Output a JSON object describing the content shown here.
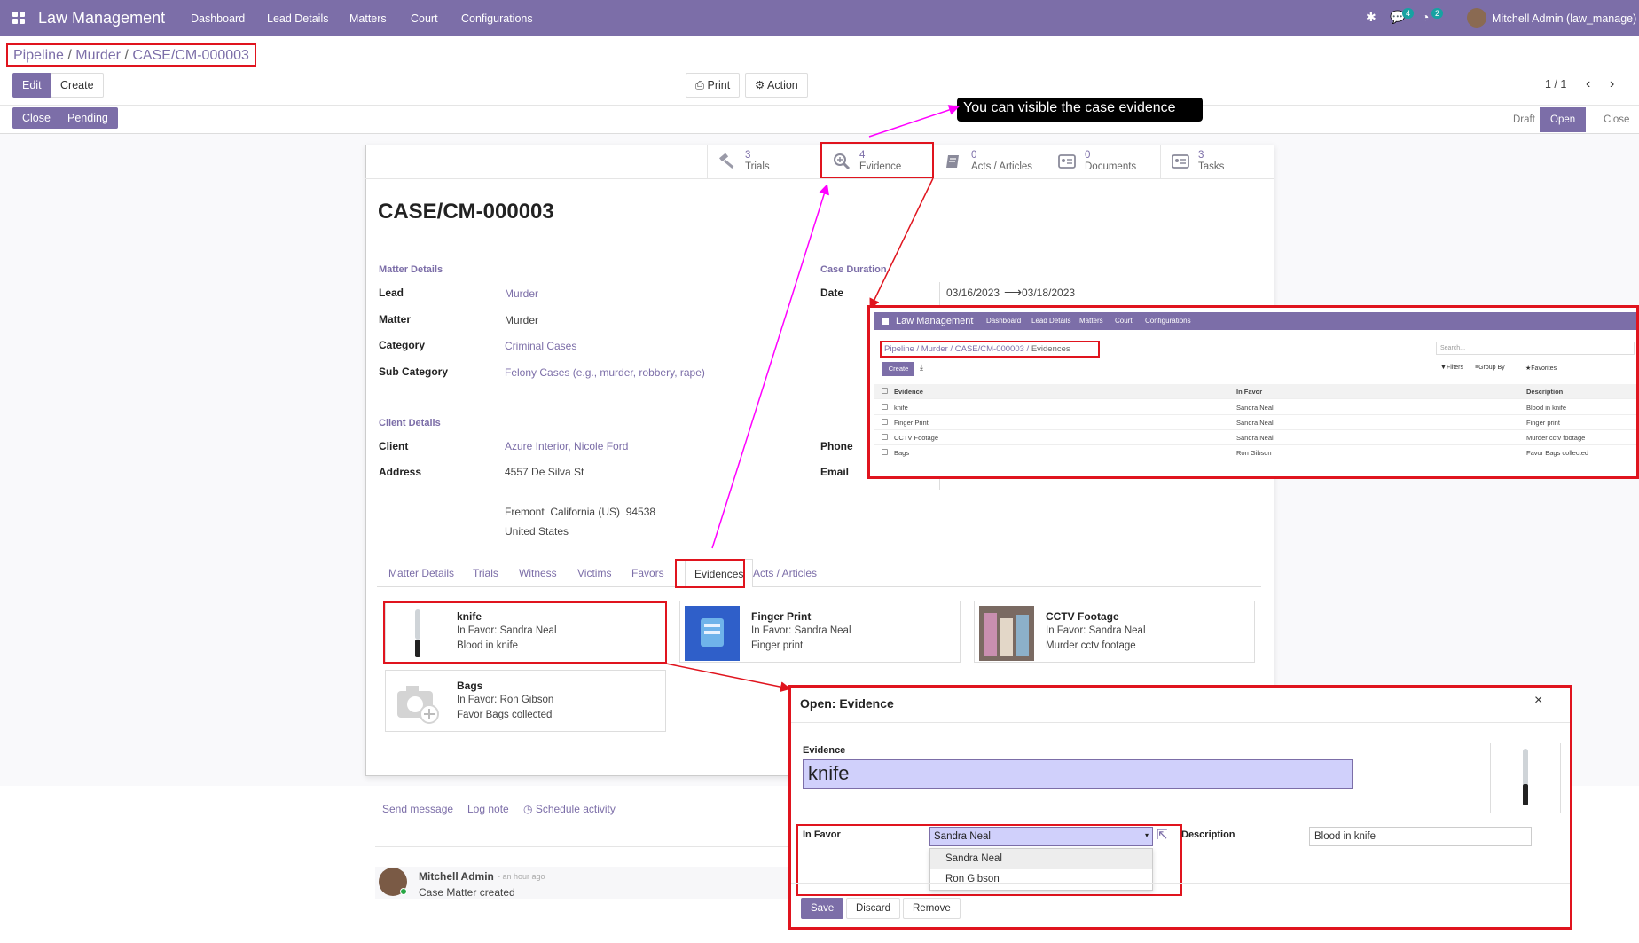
{
  "navbar": {
    "brand": "Law Management",
    "menu": [
      "Dashboard",
      "Lead Details",
      "Matters",
      "Court",
      "Configurations"
    ],
    "messages_count": "4",
    "activities_count": "2",
    "user": "Mitchell Admin (law_manage)"
  },
  "breadcrumb": {
    "items": [
      "Pipeline",
      "Murder"
    ],
    "current": "CASE/CM-000003"
  },
  "buttons": {
    "edit": "Edit",
    "create": "Create",
    "print": "Print",
    "action": "Action",
    "close": "Close",
    "pending": "Pending"
  },
  "pager": "1 / 1",
  "stages": [
    "Draft",
    "Open",
    "Close"
  ],
  "active_stage": "Open",
  "tooltip": "You can visible the case evidence",
  "smart_buttons": [
    {
      "count": "3",
      "label": "Trials",
      "icon": "gavel-icon"
    },
    {
      "count": "4",
      "label": "Evidence",
      "icon": "search-plus-icon"
    },
    {
      "count": "0",
      "label": "Acts / Articles",
      "icon": "book-icon"
    },
    {
      "count": "0",
      "label": "Documents",
      "icon": "id-card-icon"
    },
    {
      "count": "3",
      "label": "Tasks",
      "icon": "id-card-icon"
    }
  ],
  "case": {
    "title": "CASE/CM-000003"
  },
  "matter_details": {
    "heading": "Matter Details",
    "lead_label": "Lead",
    "lead": "Murder",
    "matter_label": "Matter",
    "matter": "Murder",
    "category_label": "Category",
    "category": "Criminal Cases",
    "subcategory_label": "Sub Category",
    "subcategory": "Felony Cases (e.g., murder, robbery, rape)"
  },
  "case_duration": {
    "heading": "Case Duration",
    "date_label": "Date",
    "start": "03/16/2023",
    "end": "03/18/2023"
  },
  "client_details": {
    "heading": "Client Details",
    "client_label": "Client",
    "client": "Azure Interior, Nicole Ford",
    "address_label": "Address",
    "street": "4557 De Silva St",
    "city_line": "Fremont  California (US)  94538",
    "country": "United States",
    "phone_label": "Phone",
    "email_label": "Email"
  },
  "tabs": [
    "Matter Details",
    "Trials",
    "Witness",
    "Victims",
    "Favors",
    "Evidences",
    "Acts / Articles"
  ],
  "active_tab": "Evidences",
  "evidence_cards": [
    {
      "title": "knife",
      "favor": "In Favor: Sandra Neal",
      "desc": "Blood in knife"
    },
    {
      "title": "Finger Print",
      "favor": "In Favor: Sandra Neal",
      "desc": "Finger print"
    },
    {
      "title": "CCTV Footage",
      "favor": "In Favor: Sandra Neal",
      "desc": "Murder cctv footage"
    },
    {
      "title": "Bags",
      "favor": "In Favor: Ron Gibson",
      "desc": "Favor Bags collected"
    }
  ],
  "chatter": {
    "send_message": "Send message",
    "log_note": "Log note",
    "schedule_activity": "Schedule activity",
    "author": "Mitchell Admin",
    "time": "- an hour ago",
    "message": "Case Matter created"
  },
  "inset_list": {
    "brand": "Law Management",
    "menu": [
      "Dashboard",
      "Lead Details",
      "Matters",
      "Court",
      "Configurations"
    ],
    "breadcrumb": [
      "Pipeline",
      "Murder",
      "CASE/CM-000003"
    ],
    "breadcrumb_current": "Evidences",
    "search_placeholder": "Search...",
    "create": "Create",
    "filters": "Filters",
    "group_by": "Group By",
    "favorites": "Favorites",
    "columns": [
      "Evidence",
      "In Favor",
      "Description"
    ],
    "rows": [
      [
        "knife",
        "Sandra Neal",
        "Blood in knife"
      ],
      [
        "Finger Print",
        "Sandra Neal",
        "Finger print"
      ],
      [
        "CCTV Footage",
        "Sandra Neal",
        "Murder cctv footage"
      ],
      [
        "Bags",
        "Ron Gibson",
        "Favor Bags collected"
      ]
    ]
  },
  "modal": {
    "title": "Open: Evidence",
    "evidence_label": "Evidence",
    "evidence_value": "knife",
    "in_favor_label": "In Favor",
    "in_favor_value": "Sandra Neal",
    "description_label": "Description",
    "description_value": "Blood in knife",
    "options": [
      "Sandra Neal",
      "Ron Gibson"
    ],
    "save": "Save",
    "discard": "Discard",
    "remove": "Remove"
  },
  "colors": {
    "brand": "#7c6ea8",
    "highlight": "#e0141e",
    "arrow": "#ff00ff"
  }
}
